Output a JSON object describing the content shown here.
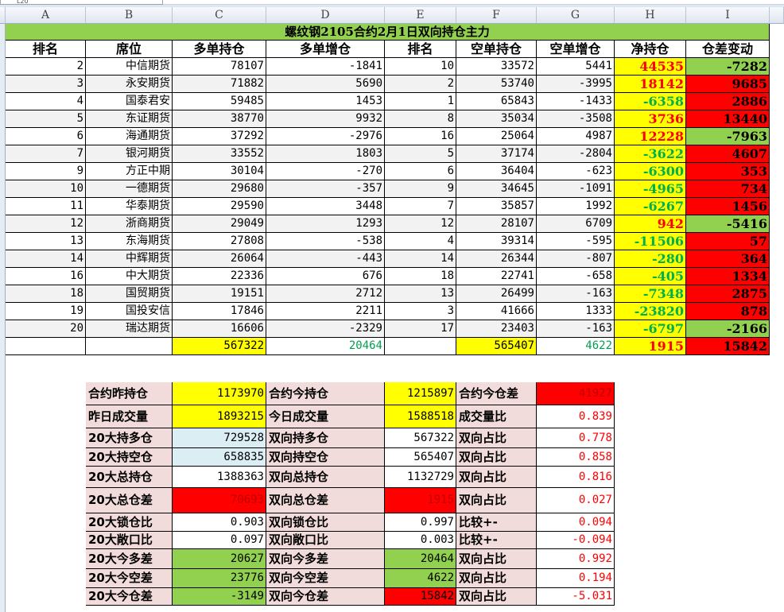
{
  "namebox": "L20",
  "columns": [
    "A",
    "B",
    "C",
    "D",
    "E",
    "F",
    "G",
    "H",
    "I"
  ],
  "title": "螺纹钢2105合约2月1日双向持仓主力",
  "headers": [
    "排名",
    "席位",
    "多单持仓",
    "多单增仓",
    "排名",
    "空单持仓",
    "空单增仓",
    "净持仓",
    "仓差变动"
  ],
  "rows": [
    {
      "rank": "2",
      "seat": "中信期货",
      "long": "78107",
      "long_chg": "-1841",
      "srank": "10",
      "short": "33572",
      "short_chg": "5441",
      "net": "44535",
      "diff": "-7282"
    },
    {
      "rank": "3",
      "seat": "永安期货",
      "long": "71882",
      "long_chg": "5690",
      "srank": "2",
      "short": "53740",
      "short_chg": "-3995",
      "net": "18142",
      "diff": "9685"
    },
    {
      "rank": "4",
      "seat": "国泰君安",
      "long": "59485",
      "long_chg": "1453",
      "srank": "1",
      "short": "65843",
      "short_chg": "-1433",
      "net": "-6358",
      "diff": "2886"
    },
    {
      "rank": "5",
      "seat": "东证期货",
      "long": "38770",
      "long_chg": "9932",
      "srank": "8",
      "short": "35034",
      "short_chg": "-3508",
      "net": "3736",
      "diff": "13440"
    },
    {
      "rank": "6",
      "seat": "海通期货",
      "long": "37292",
      "long_chg": "-2976",
      "srank": "16",
      "short": "25064",
      "short_chg": "4987",
      "net": "12228",
      "diff": "-7963"
    },
    {
      "rank": "7",
      "seat": "银河期货",
      "long": "33552",
      "long_chg": "1803",
      "srank": "5",
      "short": "37174",
      "short_chg": "-2804",
      "net": "-3622",
      "diff": "4607"
    },
    {
      "rank": "9",
      "seat": "方正中期",
      "long": "30104",
      "long_chg": "-270",
      "srank": "6",
      "short": "36404",
      "short_chg": "-623",
      "net": "-6300",
      "diff": "353"
    },
    {
      "rank": "10",
      "seat": "一德期货",
      "long": "29680",
      "long_chg": "-357",
      "srank": "9",
      "short": "34645",
      "short_chg": "-1091",
      "net": "-4965",
      "diff": "734"
    },
    {
      "rank": "11",
      "seat": "华泰期货",
      "long": "29590",
      "long_chg": "3448",
      "srank": "7",
      "short": "35857",
      "short_chg": "1992",
      "net": "-6267",
      "diff": "1456"
    },
    {
      "rank": "12",
      "seat": "浙商期货",
      "long": "29049",
      "long_chg": "1293",
      "srank": "12",
      "short": "28107",
      "short_chg": "6709",
      "net": "942",
      "diff": "-5416"
    },
    {
      "rank": "13",
      "seat": "东海期货",
      "long": "27808",
      "long_chg": "-538",
      "srank": "4",
      "short": "39314",
      "short_chg": "-595",
      "net": "-11506",
      "diff": "57"
    },
    {
      "rank": "14",
      "seat": "中辉期货",
      "long": "26064",
      "long_chg": "-443",
      "srank": "14",
      "short": "26344",
      "short_chg": "-807",
      "net": "-280",
      "diff": "364"
    },
    {
      "rank": "16",
      "seat": "中大期货",
      "long": "22336",
      "long_chg": "676",
      "srank": "18",
      "short": "22741",
      "short_chg": "-658",
      "net": "-405",
      "diff": "1334"
    },
    {
      "rank": "18",
      "seat": "国贸期货",
      "long": "19151",
      "long_chg": "2712",
      "srank": "13",
      "short": "26499",
      "short_chg": "-163",
      "net": "-7348",
      "diff": "2875"
    },
    {
      "rank": "19",
      "seat": "国投安信",
      "long": "17846",
      "long_chg": "2211",
      "srank": "3",
      "short": "41666",
      "short_chg": "1333",
      "net": "-23820",
      "diff": "878"
    },
    {
      "rank": "20",
      "seat": "瑞达期货",
      "long": "16606",
      "long_chg": "-2329",
      "srank": "17",
      "short": "23403",
      "short_chg": "-163",
      "net": "-6797",
      "diff": "-2166"
    }
  ],
  "totals": {
    "long": "567322",
    "long_chg": "20464",
    "short": "565407",
    "short_chg": "4622",
    "net": "1915",
    "diff": "15842"
  },
  "summary": [
    {
      "l1": "合约昨持仓",
      "v1": "1173970",
      "l2": "合约今持仓",
      "v2": "1215897",
      "l3": "合约今仓差",
      "v3": "41927"
    },
    {
      "l1": "昨日成交量",
      "v1": "1893215",
      "l2": "今日成交量",
      "v2": "1588518",
      "l3": "成交量比",
      "v3": "0.839"
    },
    {
      "l1": "20大持多仓",
      "v1": "729528",
      "l2": "双向持多仓",
      "v2": "567322",
      "l3": "双向占比",
      "v3": "0.778"
    },
    {
      "l1": "20大持空仓",
      "v1": "658835",
      "l2": "双向持空仓",
      "v2": "565407",
      "l3": "双向占比",
      "v3": "0.858"
    },
    {
      "l1": "20大总持仓",
      "v1": "1388363",
      "l2": "双向总持仓",
      "v2": "1132729",
      "l3": "双向占比",
      "v3": "0.816"
    },
    {
      "l1": "20大总仓差",
      "v1": "70693",
      "l2": "双向总仓差",
      "v2": "1915",
      "l3": "双向占比",
      "v3": "0.027"
    },
    {
      "l1": "20大锁仓比",
      "v1": "0.903",
      "l2": "双向锁仓比",
      "v2": "0.997",
      "l3": "比较+-",
      "v3": "0.094"
    },
    {
      "l1": "20大敞口比",
      "v1": "0.097",
      "l2": "双向敞口比",
      "v2": "0.003",
      "l3": "比较+-",
      "v3": "-0.094"
    },
    {
      "l1": "20大今多差",
      "v1": "20627",
      "l2": "双向今多差",
      "v2": "20464",
      "l3": "双向占比",
      "v3": "0.992"
    },
    {
      "l1": "20大今空差",
      "v1": "23776",
      "l2": "双向今空差",
      "v2": "4622",
      "l3": "双向占比",
      "v3": "0.194"
    },
    {
      "l1": "20大今仓差",
      "v1": "-3149",
      "l2": "双向今仓差",
      "v2": "15842",
      "l3": "双向占比",
      "v3": "-5.031"
    }
  ],
  "colors": {
    "yellow": "#ffff00",
    "red": "#ff0000",
    "green": "#92d050",
    "pink": "#f2dcdb",
    "title_bg": "#92d050"
  }
}
